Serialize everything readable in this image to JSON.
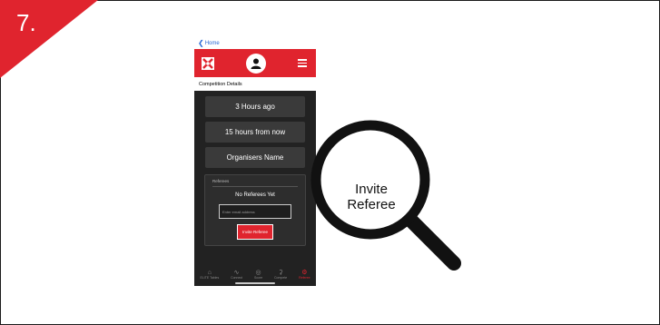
{
  "step": {
    "number": "7."
  },
  "phone": {
    "back_label": "Home",
    "section_title": "Competition Details",
    "cards": [
      {
        "text": "3 Hours ago"
      },
      {
        "text": "15 hours from now"
      },
      {
        "text": "Organisers Name"
      }
    ],
    "referees": {
      "title": "Referees",
      "empty_text": "No Referees Yet",
      "input_placeholder": "Enter email address",
      "invite_button": "Invite Referee"
    },
    "nav": [
      {
        "label": "ELITE Tables",
        "icon": "home-icon"
      },
      {
        "label": "Connect",
        "icon": "wifi-icon"
      },
      {
        "label": "Score",
        "icon": "score-icon"
      },
      {
        "label": "Compete",
        "icon": "trophy-icon"
      },
      {
        "label": "Referee",
        "icon": "gear-icon"
      }
    ]
  },
  "callout": {
    "line1": "Invite",
    "line2": "Referee"
  },
  "colors": {
    "brand_red": "#e0242e",
    "phone_bg": "#222222",
    "card_bg": "#3a3a3a"
  }
}
